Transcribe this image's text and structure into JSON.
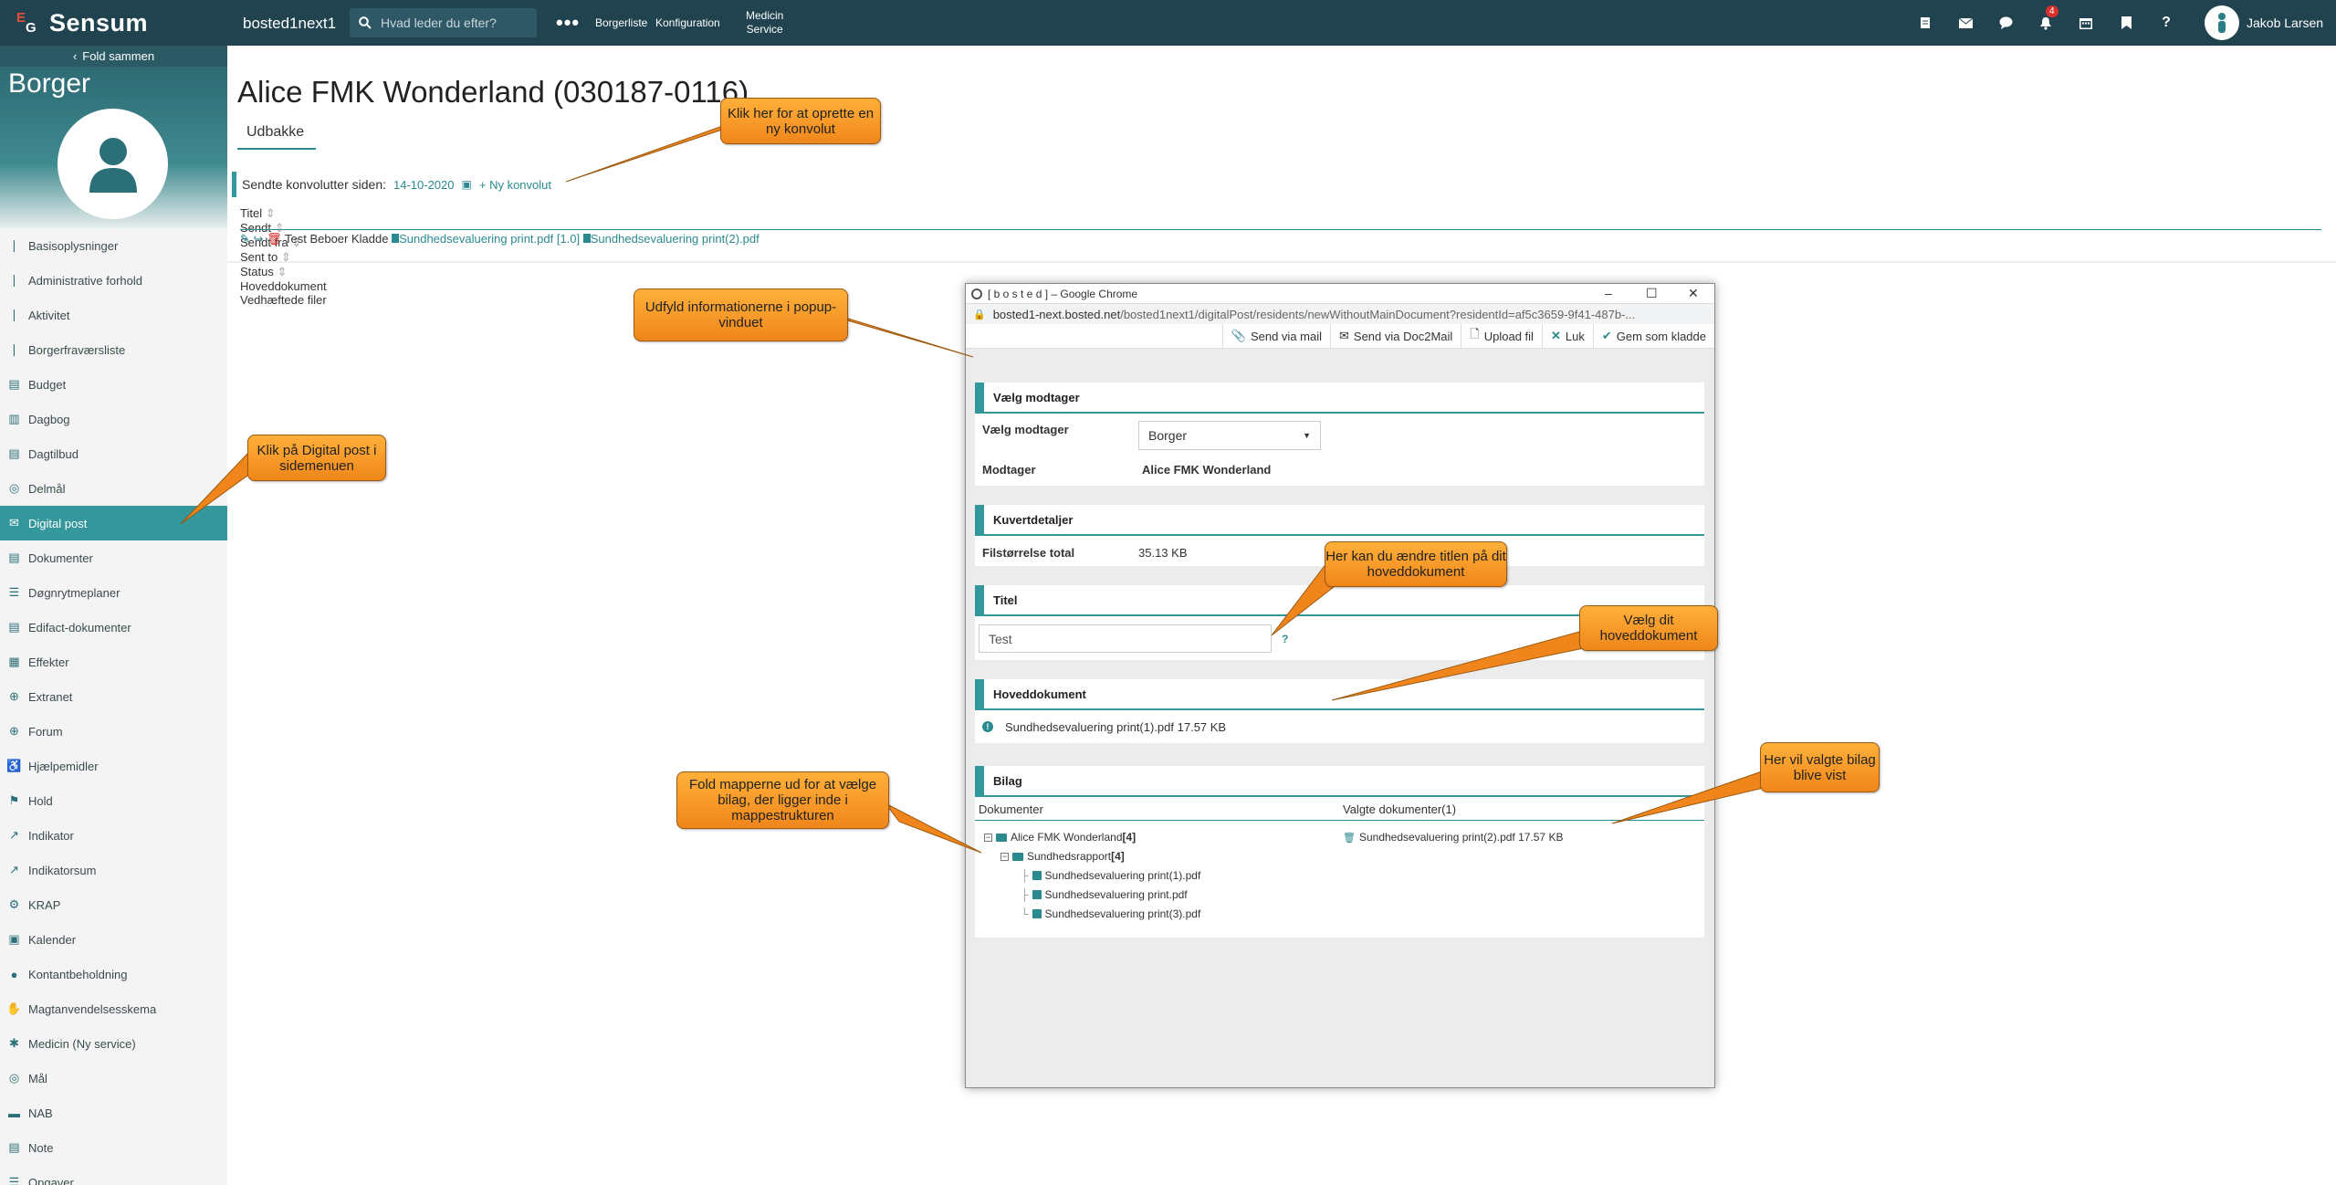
{
  "topbar": {
    "logo_text": "Sensum",
    "logo_mark": "EG",
    "tenant": "bosted1next1",
    "search_placeholder": "Hvad leder du efter?",
    "more": "•••",
    "nav": [
      "Borgerliste",
      "Konfiguration"
    ],
    "nav_medicin": [
      "Medicin",
      "Service"
    ],
    "notification_count": "4",
    "user_name": "Jakob Larsen"
  },
  "sidebar": {
    "fold_label": "Fold sammen",
    "title": "Borger",
    "items": [
      "Basisoplysninger",
      "Administrative forhold",
      "Aktivitet",
      "Borgerfraværsliste",
      "Budget",
      "Dagbog",
      "Dagtilbud",
      "Delmål",
      "Digital post",
      "Dokumenter",
      "Døgnrytmeplaner",
      "Edifact-dokumenter",
      "Effekter",
      "Extranet",
      "Forum",
      "Hjælpemidler",
      "Hold",
      "Indikator",
      "Indikatorsum",
      "KRAP",
      "Kalender",
      "Kontantbeholdning",
      "Magtanvendelsesskema",
      "Medicin (Ny service)",
      "Mål",
      "NAB",
      "Note",
      "Opgaver"
    ],
    "active": "Digital post"
  },
  "main": {
    "title": "Alice FMK Wonderland (030187-0116)",
    "tab": "Udbakke",
    "env_label": "Sendte konvolutter siden:",
    "env_date": "14-10-2020",
    "new_envelope": "Ny konvolut",
    "columns": [
      "Titel",
      "Sendt",
      "Sendt fra",
      "Sent to",
      "Status",
      "Hoveddokument",
      "Vedhæftede filer"
    ],
    "row": {
      "titel": "Test",
      "sent_to": "Beboer",
      "status": "Kladde",
      "hoveddokument": "Sundhedsevaluering print.pdf [1.0]",
      "vedhaeftede": "Sundhedsevaluering print(2).pdf"
    }
  },
  "popup": {
    "window_title": "[ b o s t e d ] – Google Chrome",
    "url_host": "bosted1-next.bosted.net",
    "url_path": "/bosted1next1/digitalPost/residents/newWithoutMainDocument?residentId=af5c3659-9f41-487b-...",
    "toolbar": [
      "Send via mail",
      "Send via Doc2Mail",
      "Upload fil",
      "Luk",
      "Gem som kladde"
    ],
    "sec_modtager": "Vælg modtager",
    "lbl_vaelg": "Vælg modtager",
    "select_value": "Borger",
    "lbl_modtager": "Modtager",
    "modtager_value": "Alice FMK Wonderland",
    "sec_kuvert": "Kuvertdetaljer",
    "lbl_fil": "Filstørrelse total",
    "fil_value": "35.13 KB",
    "sec_titel": "Titel",
    "titel_value": "Test",
    "help": "?",
    "sec_hoved": "Hoveddokument",
    "hoved_value": "Sundhedsevaluering print(1).pdf 17.57 KB",
    "sec_bilag": "Bilag",
    "col_dok": "Dokumenter",
    "col_valgte": "Valgte dokumenter(1)",
    "tree_root": "Alice FMK Wonderland",
    "tree_root_count": "[4]",
    "tree_folder": "Sundhedsrapport",
    "tree_folder_count": "[4]",
    "tree_files": [
      "Sundhedsevaluering print(1).pdf",
      "Sundhedsevaluering print.pdf",
      "Sundhedsevaluering print(3).pdf"
    ],
    "selected_doc": "Sundhedsevaluering print(2).pdf 17.57 KB"
  },
  "callouts": {
    "ny_konvolut": "Klik her for at oprette en ny konvolut",
    "udfyld": "Udfyld informationerne i popup-vinduet",
    "digital_post": "Klik på Digital post i sidemenuen",
    "titel": "Her kan du ændre titlen på dit hoveddokument",
    "hoved": "Vælg dit hoveddokument",
    "fold": "Fold mapperne ud for at vælge bilag, der ligger inde i mappestrukturen",
    "bilag": "Her vil valgte bilag blive vist"
  },
  "colors": {
    "topbar": "#20434f",
    "accent": "#33979c",
    "callout": "#f0861b"
  }
}
